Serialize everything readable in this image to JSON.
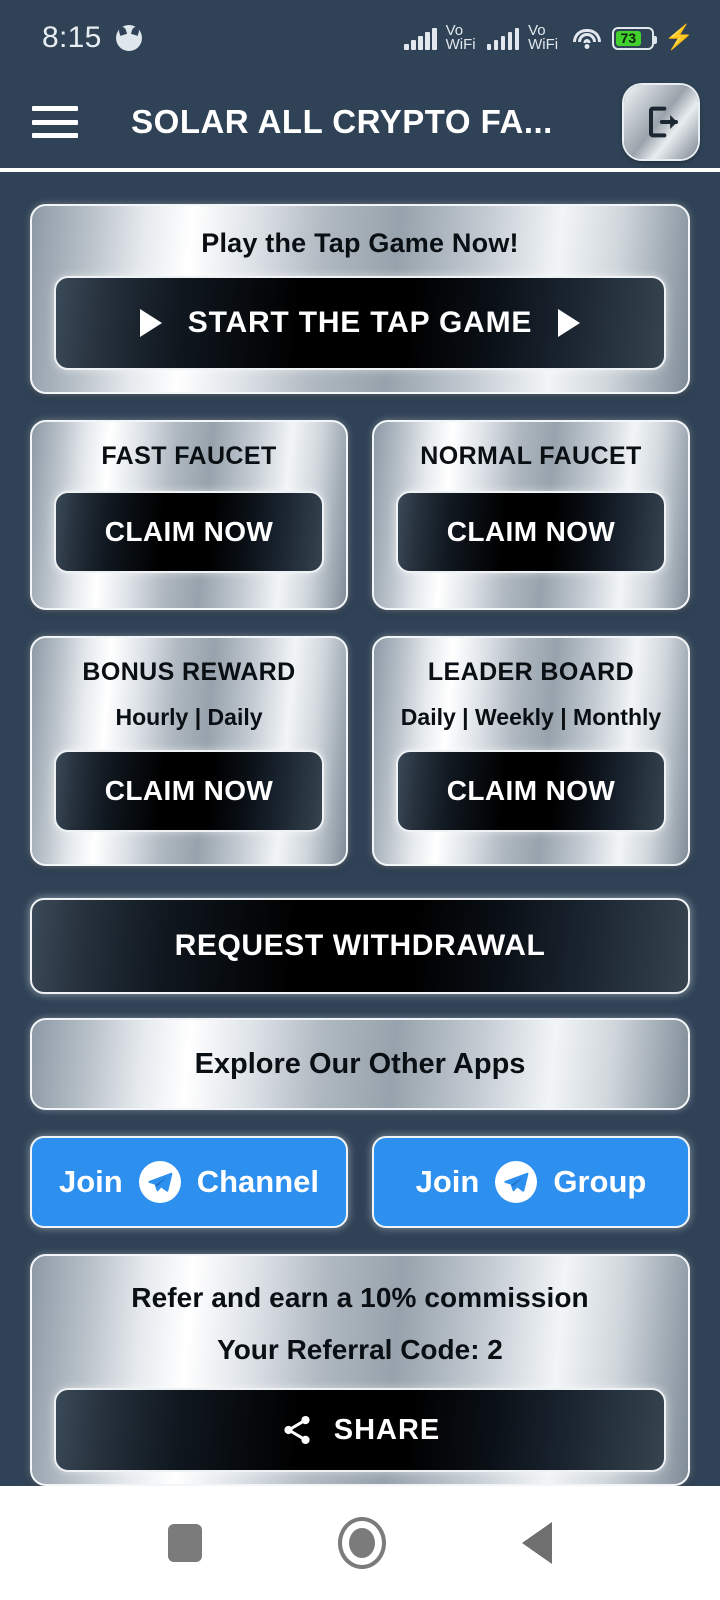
{
  "status_bar": {
    "time": "8:15",
    "app_glyph": "cat-face-icon",
    "signal_label_1": "Vo",
    "signal_sub_1": "WiFi",
    "signal_label_2": "Vo",
    "signal_sub_2": "WiFi",
    "wifi": "wifi-icon",
    "battery_percent": "73",
    "charging": true
  },
  "appbar": {
    "menu_icon": "hamburger-menu-icon",
    "title": "SOLAR ALL CRYPTO FA...",
    "logout_icon": "logout-icon"
  },
  "tap_game": {
    "title": "Play the Tap Game Now!",
    "button_label": "START THE TAP GAME"
  },
  "faucets": [
    {
      "title": "FAST FAUCET",
      "button_label": "CLAIM NOW"
    },
    {
      "title": "NORMAL FAUCET",
      "button_label": "CLAIM NOW"
    }
  ],
  "bonus_cards": [
    {
      "title": "BONUS REWARD",
      "subtitle": "Hourly | Daily",
      "button_label": "CLAIM NOW"
    },
    {
      "title": "LEADER BOARD",
      "subtitle": "Daily | Weekly | Monthly",
      "button_label": "CLAIM NOW"
    }
  ],
  "withdrawal": {
    "label": "REQUEST WITHDRAWAL"
  },
  "explore": {
    "label": "Explore Our Other Apps"
  },
  "telegram": [
    {
      "prefix": "Join",
      "suffix": "Channel",
      "icon": "telegram-icon"
    },
    {
      "prefix": "Join",
      "suffix": "Group",
      "icon": "telegram-icon"
    }
  ],
  "referral": {
    "line1": "Refer and earn a 10% commission",
    "line2": "Your Referral Code: 2",
    "share_label": "SHARE",
    "share_icon": "share-icon"
  },
  "navbar": {
    "recents": "recents-square-icon",
    "home": "home-circle-icon",
    "back": "back-triangle-icon"
  },
  "colors": {
    "background": "#2f4256",
    "telegram_blue": "#2d8fee",
    "battery_green": "#41d02c",
    "text_light": "#ffffff",
    "text_dark": "#0a0f14"
  }
}
